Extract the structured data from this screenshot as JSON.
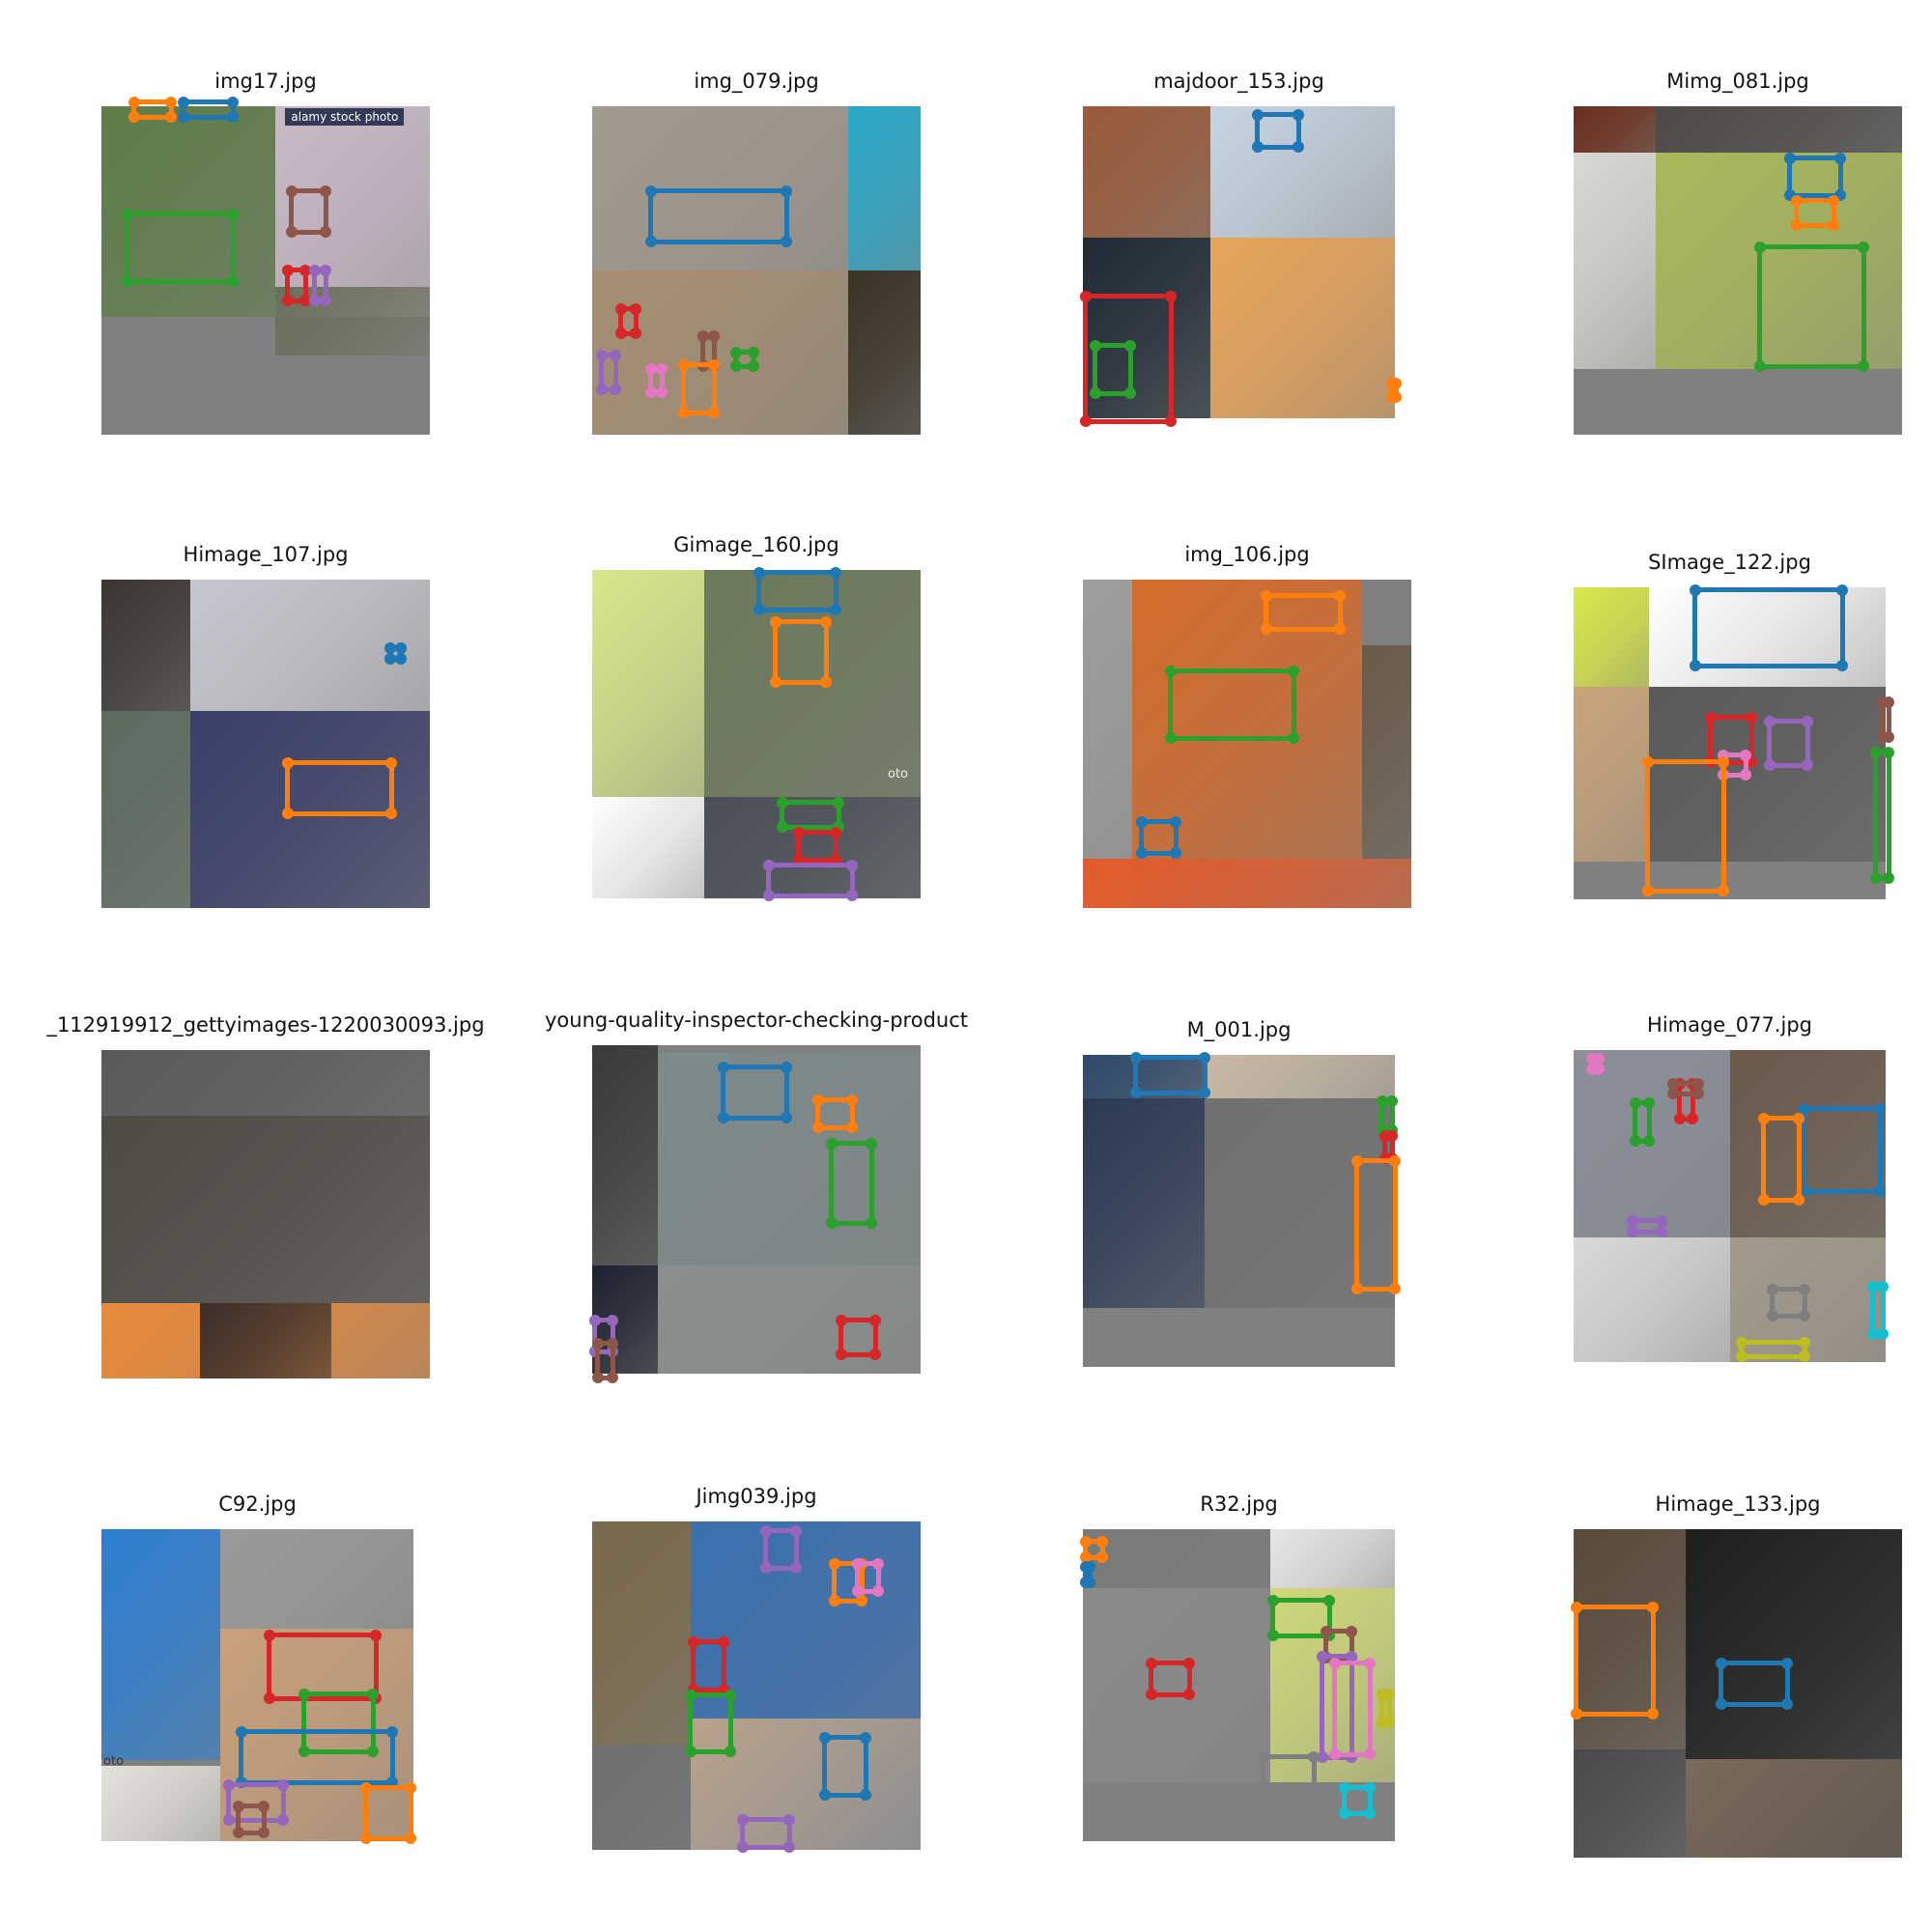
{
  "figure": {
    "tiles": [
      {
        "title": "img17.jpg",
        "colors": [
          "#5f7d49",
          "#c9b9c7",
          "#808080",
          "#6b6f5c"
        ],
        "boxes": [
          "#ff7f0e",
          "#1f77b4",
          "#2ca02c",
          "#8c564b",
          "#d62728",
          "#9467bd"
        ],
        "watermark": "alamy stock photo"
      },
      {
        "title": "img_079.jpg",
        "colors": [
          "#a39a8e",
          "#2aa9c8",
          "#a58f72",
          "#3a3326"
        ],
        "boxes": [
          "#1f77b4",
          "#d62728",
          "#8c564b",
          "#2ca02c",
          "#9467bd",
          "#e377c2",
          "#ff7f0e"
        ]
      },
      {
        "title": "majdoor_153.jpg",
        "colors": [
          "#9a5b3a",
          "#c7d4e2",
          "#1f2a36",
          "#e8a55a"
        ],
        "boxes": [
          "#1f77b4",
          "#d62728",
          "#2ca02c",
          "#ff7f0e"
        ]
      },
      {
        "title": "Mimg_081.jpg",
        "colors": [
          "#6b2e1c",
          "#4d4a47",
          "#d9d8d4",
          "#a8b95a"
        ],
        "boxes": [
          "#1f77b4",
          "#ff7f0e",
          "#2ca02c"
        ]
      },
      {
        "title": "Himage_107.jpg",
        "colors": [
          "#3b3632",
          "#c7c7cf",
          "#5c6b5f",
          "#3a3f6a"
        ],
        "boxes": [
          "#1f77b4",
          "#ff7f0e"
        ]
      },
      {
        "title": "Gimage_160.jpg",
        "colors": [
          "#d8e78a",
          "#6c7a5b",
          "#ffffff",
          "#4a4f56"
        ],
        "boxes": [
          "#1f77b4",
          "#ff7f0e",
          "#2ca02c",
          "#d62728",
          "#9467bd"
        ],
        "watermark": "oto"
      },
      {
        "title": "img_106.jpg",
        "colors": [
          "#9e9e9e",
          "#d46b2c",
          "#6a5b4a",
          "#e45b2a"
        ],
        "boxes": [
          "#ff7f0e",
          "#2ca02c",
          "#1f77b4"
        ]
      },
      {
        "title": "SImage_122.jpg",
        "colors": [
          "#d8e84a",
          "#ffffff",
          "#c9a47a",
          "#5a5a5a"
        ],
        "boxes": [
          "#1f77b4",
          "#d62728",
          "#9467bd",
          "#8c564b",
          "#e377c2",
          "#ff7f0e",
          "#2ca02c"
        ]
      },
      {
        "title": "_112919912_gettyimages-1220030093.jpg",
        "colors": [
          "#5a5a5a",
          "#4e4a44",
          "#e88a3a",
          "#3a2e2a"
        ],
        "boxes": []
      },
      {
        "title": "young-quality-inspector-checking-product",
        "colors": [
          "#3a3a3a",
          "#7d8a8a",
          "#1e2130",
          "#8a8f8c"
        ],
        "boxes": [
          "#1f77b4",
          "#ff7f0e",
          "#2ca02c",
          "#9467bd",
          "#8c564b",
          "#d62728"
        ]
      },
      {
        "title": "M_001.jpg",
        "colors": [
          "#2e4a6b",
          "#c8b9a5",
          "#2c3a55",
          "#707070"
        ],
        "boxes": [
          "#1f77b4",
          "#2ca02c",
          "#d62728",
          "#ff7f0e"
        ]
      },
      {
        "title": "Himage_077.jpg",
        "colors": [
          "#8a8f9a",
          "#6b5a4c",
          "#d9d9d9",
          "#a39a8a"
        ],
        "boxes": [
          "#1f77b4",
          "#ff7f0e",
          "#2ca02c",
          "#d62728",
          "#9467bd",
          "#8c564b",
          "#e377c2",
          "#7f7f7f",
          "#bcbd22",
          "#17becf"
        ]
      },
      {
        "title": "C92.jpg",
        "colors": [
          "#2e7fd1",
          "#9a9a9a",
          "#c9a07a",
          "#e5e2dd"
        ],
        "boxes": [
          "#d62728",
          "#2ca02c",
          "#1f77b4",
          "#9467bd",
          "#8c564b",
          "#ff7f0e"
        ],
        "watermark": "oto"
      },
      {
        "title": "Jimg039.jpg",
        "colors": [
          "#7a6a4a",
          "#3a6fb0",
          "#6f6f6f",
          "#b9a28a"
        ],
        "boxes": [
          "#9467bd",
          "#ff7f0e",
          "#e377c2",
          "#d62728",
          "#2ca02c",
          "#1f77b4"
        ]
      },
      {
        "title": "R32.jpg",
        "colors": [
          "#7a7a7a",
          "#e6e6e6",
          "#8a8a8a",
          "#cfd87a"
        ],
        "boxes": [
          "#ff7f0e",
          "#1f77b4",
          "#d62728",
          "#2ca02c",
          "#8c564b",
          "#9467bd",
          "#e377c2",
          "#bcbd22",
          "#17becf",
          "#7f7f7f"
        ]
      },
      {
        "title": "Himage_133.jpg",
        "colors": [
          "#5a4a3a",
          "#1e1e1e",
          "#4a4a4a",
          "#7a6a5a"
        ],
        "boxes": [
          "#ff7f0e",
          "#1f77b4"
        ]
      }
    ]
  }
}
